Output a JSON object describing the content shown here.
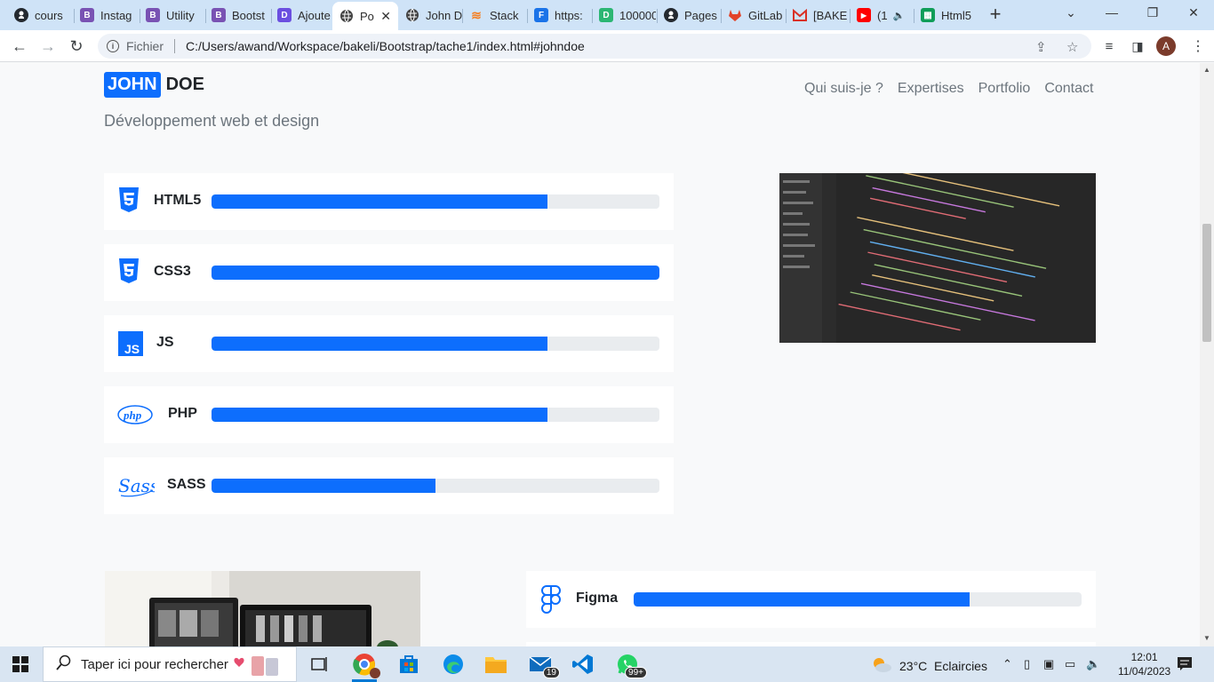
{
  "browser": {
    "tabs": [
      {
        "label": "cours",
        "icon": "github-icon",
        "color": "#24292f"
      },
      {
        "label": "Instag",
        "icon": "bootstrap-icon",
        "color": "#7952b3"
      },
      {
        "label": "Utility",
        "icon": "bootstrap-icon",
        "color": "#7952b3"
      },
      {
        "label": "Bootst",
        "icon": "bootstrap-icon",
        "color": "#7952b3"
      },
      {
        "label": "Ajoute",
        "icon": "app-icon",
        "color": "#6b4fe0"
      },
      {
        "label": "Po",
        "icon": "globe-icon",
        "color": "#444444",
        "active": true
      },
      {
        "label": "John D",
        "icon": "globe-icon",
        "color": "#444444"
      },
      {
        "label": "Stack",
        "icon": "stackoverflow-icon",
        "color": "#f48024"
      },
      {
        "label": "https:",
        "icon": "forms-icon",
        "color": "#1a73e8"
      },
      {
        "label": "100000",
        "icon": "d-icon",
        "color": "#2bb673"
      },
      {
        "label": "Pages",
        "icon": "github-icon",
        "color": "#24292f"
      },
      {
        "label": "GitLab",
        "icon": "gitlab-icon",
        "color": "#e24329"
      },
      {
        "label": "[BAKE",
        "icon": "gmail-icon",
        "color": "#d93025"
      },
      {
        "label": "(1",
        "icon": "youtube-icon",
        "color": "#ff0000"
      },
      {
        "label": "Html5",
        "icon": "sheets-icon",
        "color": "#0f9d58"
      }
    ],
    "url_scheme": "Fichier",
    "url": "C:/Users/awand/Workspace/bakeli/Bootstrap/tache1/index.html#johndoe",
    "profile_initial": "A"
  },
  "page": {
    "brand_first": "JOHN",
    "brand_last": "DOE",
    "tagline": "Développement web et design",
    "nav": [
      "Qui suis-je ?",
      "Expertises",
      "Portfolio",
      "Contact"
    ],
    "skills": [
      {
        "name": "HTML5",
        "level": 0.75,
        "icon": "html5-icon",
        "color": "#0d6efd"
      },
      {
        "name": "CSS3",
        "level": 1.0,
        "icon": "css3-icon",
        "color": "#0d6efd"
      },
      {
        "name": "JS",
        "level": 0.75,
        "icon": "js-icon",
        "color": "#0d6efd"
      },
      {
        "name": "PHP",
        "level": 0.75,
        "icon": "php-icon",
        "color": "#0d6efd"
      },
      {
        "name": "SASS",
        "level": 0.5,
        "icon": "sass-icon",
        "color": "#0d6efd"
      }
    ],
    "skill_right": {
      "name": "Figma",
      "level": 0.75,
      "icon": "figma-icon"
    },
    "accent": "#0d6efd"
  },
  "taskbar": {
    "search_placeholder": "Taper ici pour rechercher",
    "mail_badge": "19",
    "whatsapp_badge": "99+",
    "weather": "23°C  Eclaircies",
    "time": "12:01",
    "date": "11/04/2023"
  }
}
